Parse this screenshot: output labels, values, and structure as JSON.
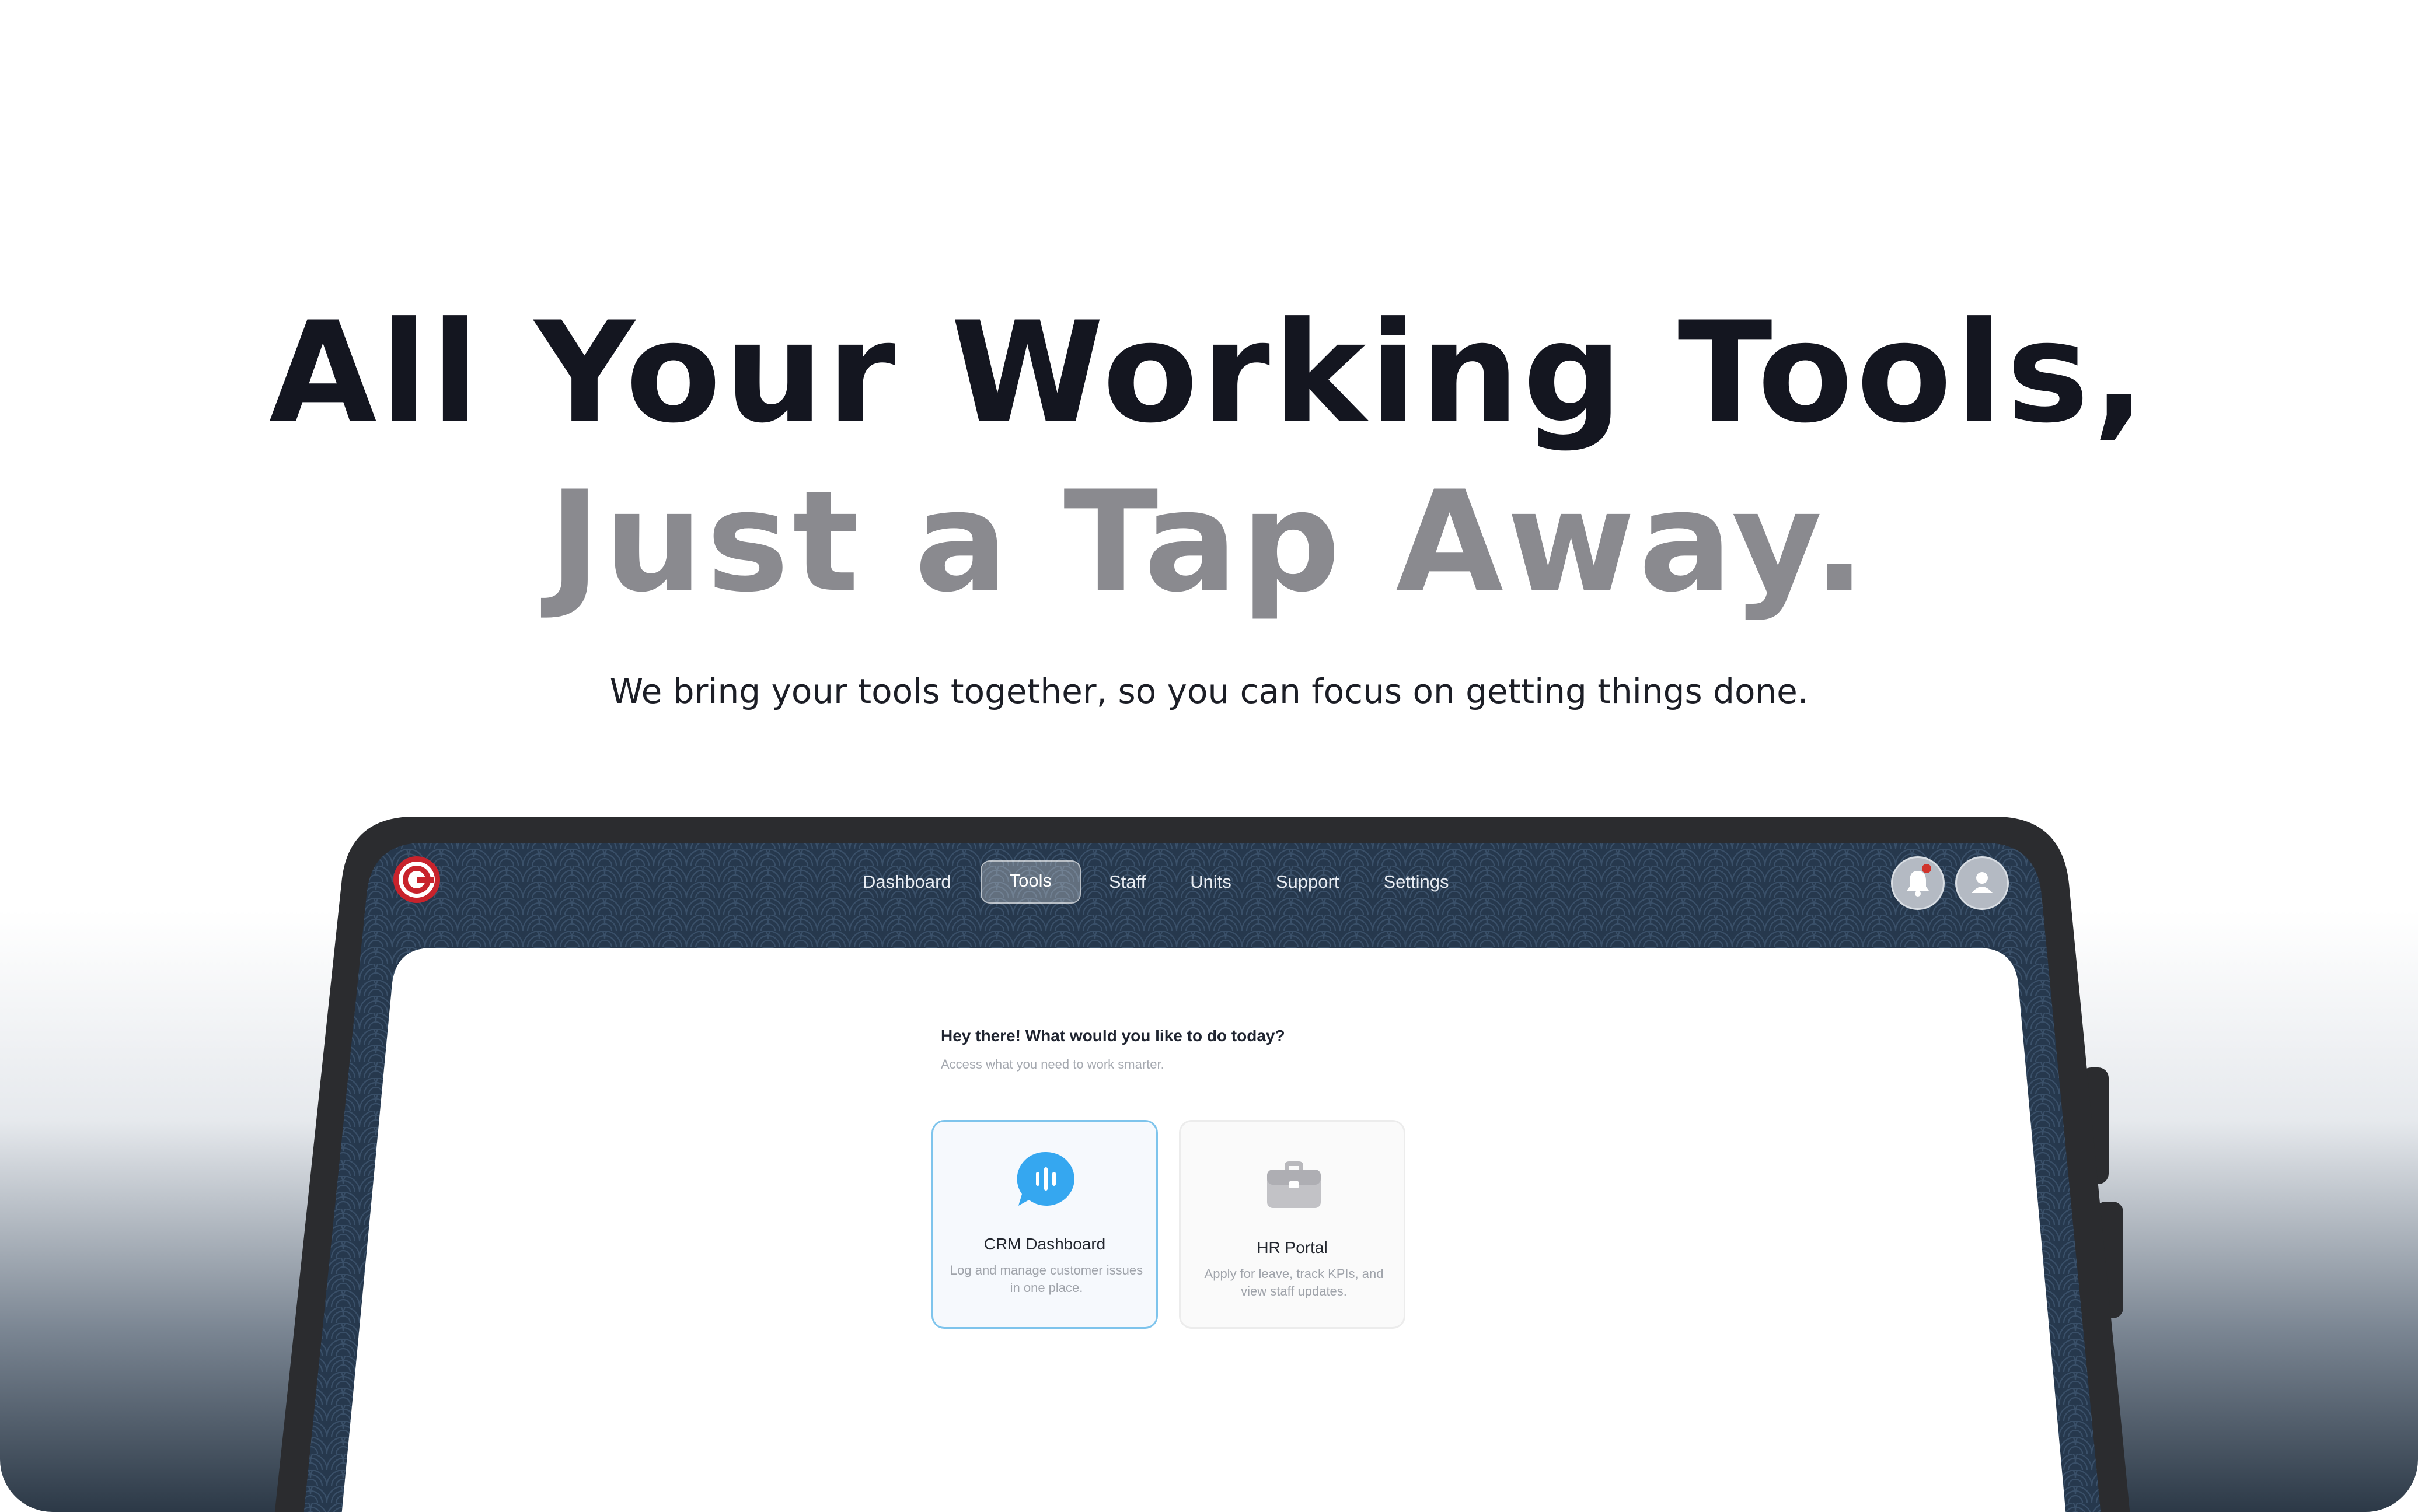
{
  "hero": {
    "title_line1": "All Your Working Tools,",
    "title_line2": "Just a Tap Away.",
    "subtitle": "We bring your tools together, so you can focus on getting things done."
  },
  "app": {
    "nav": {
      "items": [
        {
          "label": "Dashboard"
        },
        {
          "label": "Tools",
          "active": true
        },
        {
          "label": "Staff"
        },
        {
          "label": "Units"
        },
        {
          "label": "Support"
        },
        {
          "label": "Settings"
        }
      ]
    },
    "icons": {
      "logo": "brand-logo-icon",
      "bell": "bell-icon",
      "user": "user-icon",
      "crm": "chat-bubble-audio-icon",
      "hr": "briefcase-icon"
    },
    "main": {
      "greeting": "Hey there! What would you like to do today?",
      "greeting_sub": "Access what you need to work smarter.",
      "cards": [
        {
          "title": "CRM Dashboard",
          "description": "Log and manage customer issues in one place.",
          "selected": true
        },
        {
          "title": "HR Portal",
          "description": "Apply for leave, track KPIs, and view staff updates."
        }
      ]
    }
  },
  "colors": {
    "accent_blue": "#35a7f0",
    "brand_red": "#c8232c",
    "nav_background": "#26384d",
    "notification": "#d0342c"
  }
}
